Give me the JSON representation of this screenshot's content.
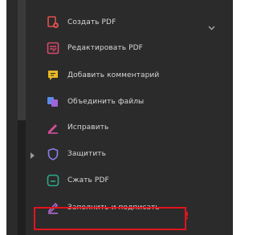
{
  "tools_menu": {
    "items": [
      {
        "label": "Создать PDF",
        "icon": "create-pdf-icon",
        "color": "#e0524f"
      },
      {
        "label": "Редактировать PDF",
        "icon": "edit-pdf-icon",
        "color": "#d9496b"
      },
      {
        "label": "Добавить комментарий",
        "icon": "comment-icon",
        "color": "#e8b923"
      },
      {
        "label": "Объединить файлы",
        "icon": "combine-files-icon",
        "color": "#7b7be0"
      },
      {
        "label": "Исправить",
        "icon": "redact-icon",
        "color": "#d0509a"
      },
      {
        "label": "Защитить",
        "icon": "protect-icon",
        "color": "#8a7de8"
      },
      {
        "label": "Сжать PDF",
        "icon": "compress-pdf-icon",
        "color": "#2ca88a"
      },
      {
        "label": "Заполнить и подписать",
        "icon": "fill-sign-icon",
        "color": "#b36bd6"
      }
    ]
  },
  "annotation": {
    "mark": "!",
    "color": "#e2141d"
  }
}
